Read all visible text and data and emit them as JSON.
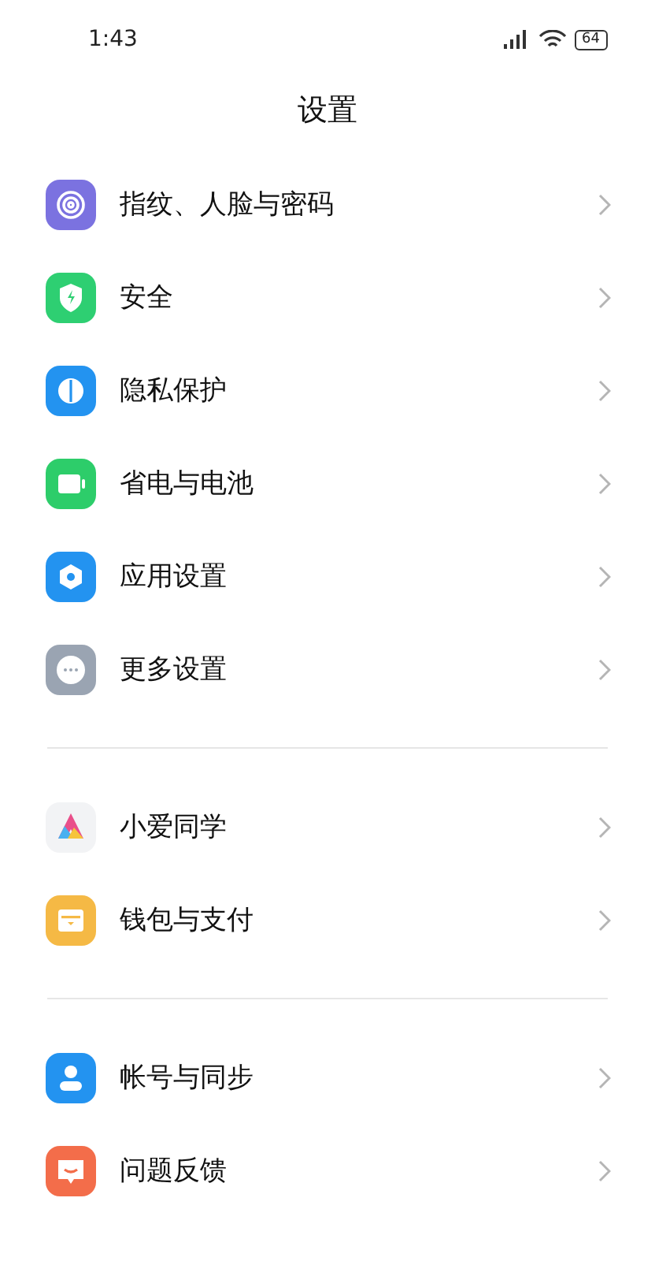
{
  "status_bar": {
    "time": "1:43",
    "battery": "64"
  },
  "title": "设置",
  "groups": [
    {
      "items": [
        {
          "label": "指纹、人脸与密码",
          "color": "#7b72e0"
        },
        {
          "label": "安全",
          "color": "#2ecf72"
        },
        {
          "label": "隐私保护",
          "color": "#2393f0"
        },
        {
          "label": "省电与电池",
          "color": "#2dcd6a"
        },
        {
          "label": "应用设置",
          "color": "#2393f0"
        },
        {
          "label": "更多设置",
          "color": "#9aa4b2"
        }
      ]
    },
    {
      "items": [
        {
          "label": "小爱同学",
          "color": "#f2f3f5"
        },
        {
          "label": "钱包与支付",
          "color": "#f5b945"
        }
      ]
    },
    {
      "items": [
        {
          "label": "帐号与同步",
          "color": "#2393f0"
        },
        {
          "label": "问题反馈",
          "color": "#f36d4a"
        }
      ]
    }
  ]
}
